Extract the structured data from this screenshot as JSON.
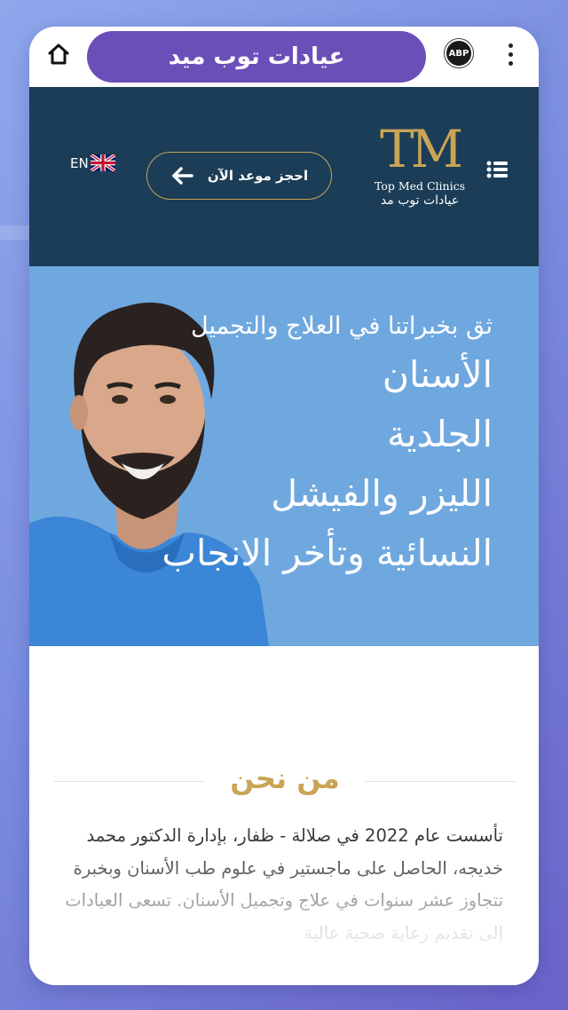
{
  "browser": {
    "home_icon": "home-icon",
    "url_title": "عيادات توب ميد",
    "adblock_label": "ABP",
    "menu_icon": "kebab-menu-icon"
  },
  "header": {
    "lang_label": "EN",
    "flag_icon": "uk-flag-icon",
    "book_button_label": "احجز موعد الآن",
    "arrow_icon": "arrow-left-icon",
    "logo_mark": "TM",
    "logo_en": "Top Med Clinics",
    "logo_ar": "عيادات توب مد",
    "menu_icon": "list-menu-icon",
    "colors": {
      "navy": "#1b3d57",
      "gold": "#c9a455"
    }
  },
  "hero": {
    "tagline": "ثق بخبراتنا في العلاج والتجميل",
    "services": [
      "الأسنان",
      "الجلدية",
      "الليزر والفيشل",
      "النسائية وتأخر الانجاب"
    ],
    "background_color": "#6fa8df"
  },
  "about": {
    "title": "من نحن",
    "body": "تأسست عام 2022 في صلالة - ظفار، بإدارة الدكتور محمد خديجه، الحاصل على ماجستير في علوم طب الأسنان وبخبرة تتجاوز عشر سنوات في علاج وتجميل الأسنان. تسعى العيادات إلى تقديم رعاية صحية عالية"
  }
}
